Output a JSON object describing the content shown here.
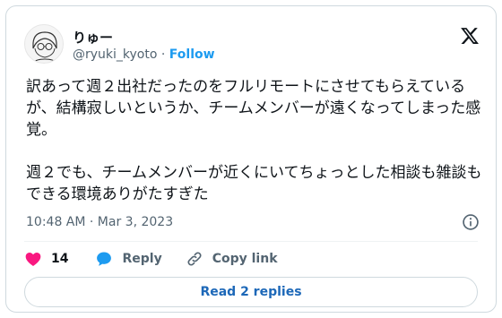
{
  "author": {
    "display_name": "りゅー",
    "handle": "@ryuki_kyoto",
    "separator": "·",
    "follow_label": "Follow"
  },
  "tweet": {
    "text": "訳あって週２出社だったのをフルリモートにさせてもらえているが、結構寂しいというか、チームメンバーが遠くなってしまった感覚。\n\n週２でも、チームメンバーが近くにいてちょっとした相談も雑談もできる環境ありがたすぎた",
    "timestamp": "10:48 AM · Mar 3, 2023"
  },
  "actions": {
    "like_count": "14",
    "reply_label": "Reply",
    "copy_link_label": "Copy link"
  },
  "read_replies_label": "Read 2 replies",
  "colors": {
    "accent": "#1d9bf0",
    "like": "#f91880",
    "muted": "#536471"
  },
  "icons": [
    "x-logo-icon",
    "info-icon",
    "heart-icon",
    "reply-bubble-icon",
    "link-icon"
  ]
}
